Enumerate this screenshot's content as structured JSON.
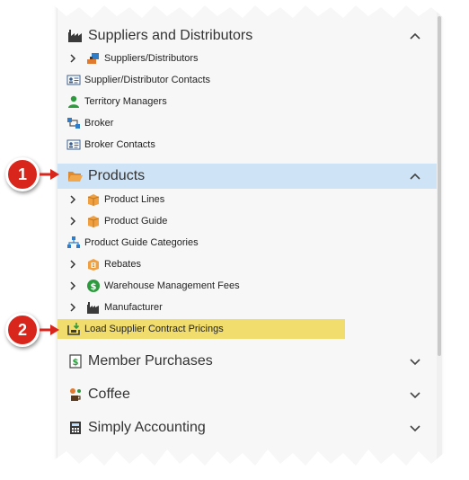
{
  "colors": {
    "selected_row": "#cfe3f6",
    "highlight_row": "#f0dd6e",
    "badge": "#d9261c"
  },
  "top_partial_text": "",
  "bottom_partial_text": "",
  "groups": {
    "suppliers": {
      "label": "Suppliers and Distributors",
      "icon": "factory-icon",
      "expanded": true
    },
    "products": {
      "label": "Products",
      "icon": "folder-open-icon",
      "expanded": true,
      "selected": true
    },
    "member_purchases": {
      "label": "Member Purchases",
      "icon": "dollar-document-icon",
      "expanded": false
    },
    "coffee": {
      "label": "Coffee",
      "icon": "coffee-icon",
      "expanded": false
    },
    "simply_accounting": {
      "label": "Simply Accounting",
      "icon": "calculator-icon",
      "expanded": false
    }
  },
  "suppliers_items": [
    {
      "label": "Suppliers/Distributors",
      "icon": "supplier-icon",
      "expandable": true
    },
    {
      "label": "Supplier/Distributor Contacts",
      "icon": "contact-card-icon",
      "expandable": false
    },
    {
      "label": "Territory Managers",
      "icon": "person-icon",
      "expandable": false
    },
    {
      "label": "Broker",
      "icon": "broker-icon",
      "expandable": false
    },
    {
      "label": "Broker Contacts",
      "icon": "contact-card-icon",
      "expandable": false
    }
  ],
  "products_items": [
    {
      "label": "Product Lines",
      "icon": "box-icon",
      "expandable": true
    },
    {
      "label": "Product Guide",
      "icon": "box-icon",
      "expandable": true
    },
    {
      "label": "Product Guide Categories",
      "icon": "hierarchy-icon",
      "expandable": false
    },
    {
      "label": "Rebates",
      "icon": "rebate-box-icon",
      "expandable": true
    },
    {
      "label": "Warehouse Management Fees",
      "icon": "dollar-coin-icon",
      "expandable": true
    },
    {
      "label": "Manufacturer",
      "icon": "factory-icon",
      "expandable": true
    },
    {
      "label": "Load Supplier Contract Pricings",
      "icon": "load-pricing-icon",
      "expandable": false,
      "highlighted": true
    }
  ],
  "callouts": [
    {
      "number": "1",
      "points_to": "Products"
    },
    {
      "number": "2",
      "points_to": "Load Supplier Contract Pricings"
    }
  ]
}
